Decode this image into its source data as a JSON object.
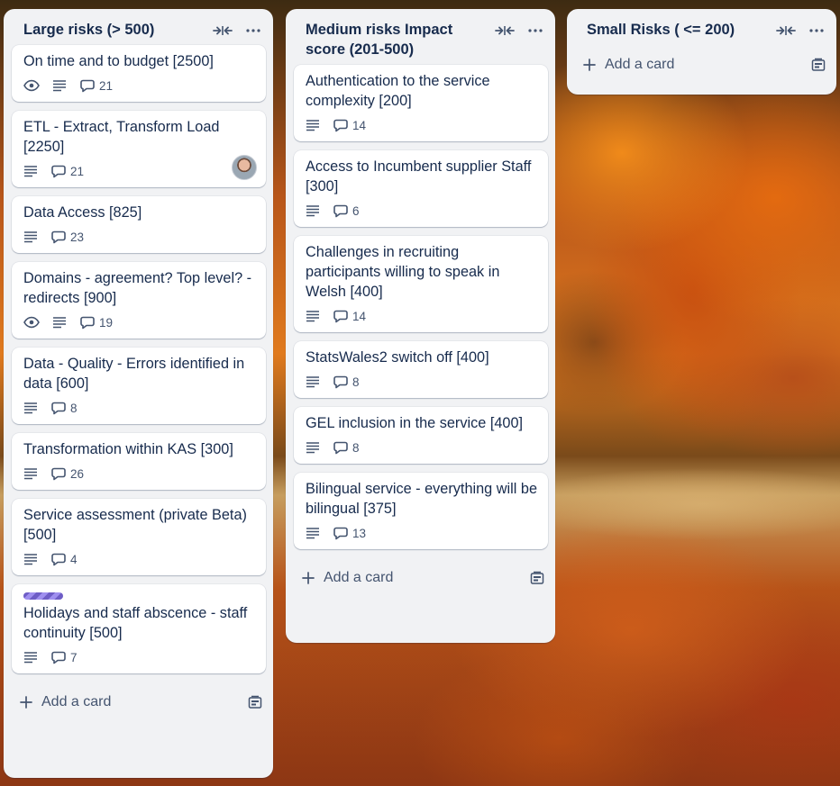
{
  "lists": [
    {
      "title": "Large risks (> 500)",
      "add_card_label": "Add a card",
      "cards": [
        {
          "title": "On time and to budget [2500]",
          "watch": true,
          "description": true,
          "comments": "21"
        },
        {
          "title": "ETL - Extract, Transform Load [2250]",
          "watch": false,
          "description": true,
          "comments": "21",
          "avatar": true
        },
        {
          "title": "Data Access [825]",
          "watch": false,
          "description": true,
          "comments": "23"
        },
        {
          "title": "Domains - agreement? Top level? - redirects [900]",
          "watch": true,
          "description": true,
          "comments": "19"
        },
        {
          "title": "Data - Quality - Errors identified in data [600]",
          "watch": false,
          "description": true,
          "comments": "8"
        },
        {
          "title": "Transformation within KAS [300]",
          "watch": false,
          "description": true,
          "comments": "26"
        },
        {
          "title": "Service assessment (private Beta) [500]",
          "watch": false,
          "description": true,
          "comments": "4"
        },
        {
          "title": "Holidays and staff abscence - staff continuity [500]",
          "watch": false,
          "description": true,
          "comments": "7",
          "label": "purple-pattern"
        }
      ]
    },
    {
      "title": "Medium risks Impact score (201-500)",
      "add_card_label": "Add a card",
      "cards": [
        {
          "title": "Authentication to the service complexity [200]",
          "description": true,
          "comments": "14"
        },
        {
          "title": "Access to Incumbent supplier Staff [300]",
          "description": true,
          "comments": "6"
        },
        {
          "title": "Challenges in recruiting participants willing to speak in Welsh [400]",
          "description": true,
          "comments": "14"
        },
        {
          "title": "StatsWales2 switch off [400]",
          "description": true,
          "comments": "8"
        },
        {
          "title": "GEL inclusion in the service [400]",
          "description": true,
          "comments": "8"
        },
        {
          "title": "Bilingual service - everything will be bilingual [375]",
          "description": true,
          "comments": "13"
        }
      ]
    },
    {
      "title": "Small Risks ( <= 200)",
      "add_card_label": "Add a card",
      "cards": []
    }
  ],
  "icons": {
    "collapse": "collapse-icon",
    "more": "more-icon",
    "watch": "eye-icon",
    "description": "description-icon",
    "comments": "comment-icon",
    "add": "plus-icon",
    "template": "template-icon"
  },
  "colors": {
    "list_bg": "#f1f2f4",
    "card_bg": "#ffffff",
    "text": "#172b4d",
    "muted": "#44546f",
    "label_purple": "#6e5dc6"
  }
}
